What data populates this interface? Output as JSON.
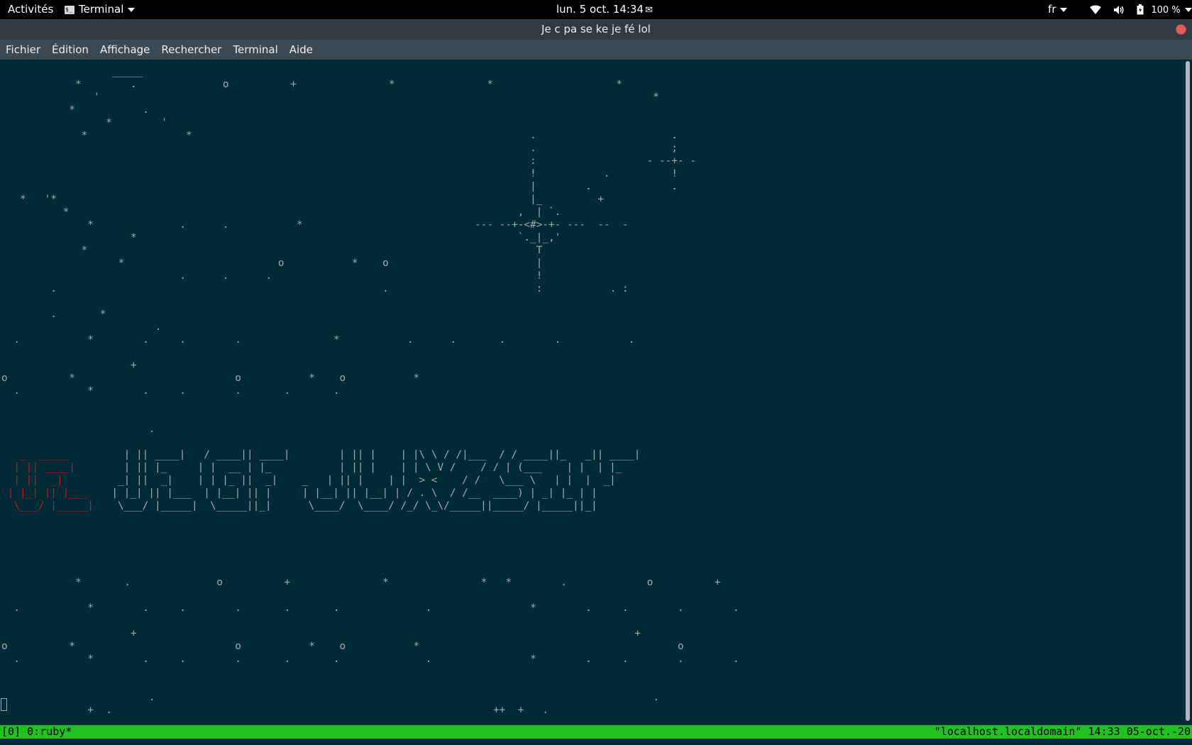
{
  "topbar": {
    "activities": "Activités",
    "app_menu": "Terminal",
    "app_icon_text": "$_",
    "clock": "lun. 5 oct.  14:34",
    "mail_icon": "✉",
    "keyboard_layout": "fr",
    "battery_percent": "100 %"
  },
  "window": {
    "title": "Je c pa se ke je fé lol"
  },
  "menubar": {
    "items": [
      "Fichier",
      "Édition",
      "Affichage",
      "Rechercher",
      "Terminal",
      "Aide"
    ]
  },
  "terminal": {
    "starfield": "                  _____\n            *        .              o          +               *               *                    *\n               '                                                                                          *\n           *           .\n                 *        '\n             *                *                                                       .                      .\n                                                                                      .                      ;\n                                                                                      :                  - --+- -\n                                                                                      !           .          !\n                                                                                      |        .             .\n   *   '*                                                                             |_         +\n          *                                                                         ,  | `.\n              *              .      .           *                            --- --+-<#>-+- ---  --  -\n                     *                                                              `._|_,'\n             *                                                                         T\n                   *                         o           *    o                        |\n                             .      .      .                                           !\n        .                                                     .                        :           . :\n\n        .       *\n                         .\n  .           *        .     .        .               *           .      .       .        .           .\n\n                     +\no          *                          o           *    o           *\n  .           *        .     .        .       .       .\n\n\n                        .",
    "lower_starfield": "\n\n\n\n\n\n\n\n\n\n            *       .              o          +               *               *   *        .             o          +\n\n  .           *        .     .        .       .       .              .                *        .     .        .        .\n\n                     +                                                                                 +\no          *                          o           *    o           *                                          o\n  .           *        .     .        .       .       .              .                *        .     .        .        .\n\n\n                        .                                                                                 .\n              +  .                                                              ++  +   ."
  },
  "banner": {
    "red_part": "   _  _____  \n  | || ____| \n  | ||  _|   \n | |_| || |___ \n  \\___/ |_____|",
    "lines": [
      "          _    _____     _____    ______           _   _       _   _      __   __ ______    _____   _____   _______",
      "    | || ____|   / ____|| ____|        | || |    | |\\ \\ / /|___  / / ____||_   _|| ____|",
      "    | || |_     | |  __ | |_           | || |    | | \\ V /    / / | (___    | |  | |_",
      "   _| ||  _|    | | |_ ||  _|    _   | || |    | |  > <    / /   \\___ \\   | |  |  _|",
      "  | |_| || |___  | |__| || |     | |__| || |__| | / . \\  / /__  ____) | _| |_ | |",
      "   \\___/ |_____|  \\_____||_|      \\____/  \\____/ /_/ \\_\\/_____||_____/ |_____||_|"
    ]
  },
  "statusbar": {
    "left": "[0] 0:ruby*",
    "right": "\"localhost.localdomain\" 14:33 05-oct.-20"
  },
  "colors": {
    "terminal_bg": "#002b36",
    "terminal_fg": "#a0aaad",
    "banner_red": "#c4181a",
    "status_green": "#1fc21f",
    "menubar_bg": "#3c4852",
    "titlebar_bg": "#2f3a43"
  },
  "icons": {
    "app": "terminal-icon",
    "network": "wifi-icon",
    "sound": "speaker-icon",
    "battery": "battery-icon",
    "close": "close-icon",
    "mail": "mail-icon"
  }
}
